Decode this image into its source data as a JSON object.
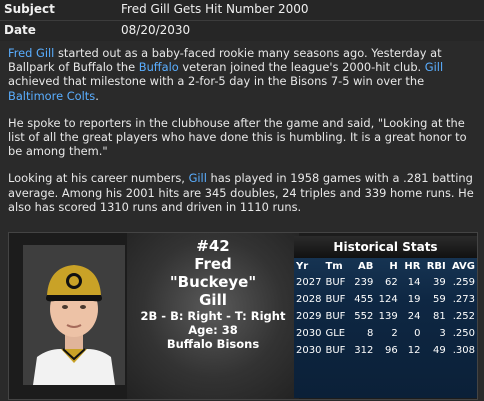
{
  "message": {
    "subject_label": "Subject",
    "subject": "Fred Gill Gets Hit Number 2000",
    "date_label": "Date",
    "date": "08/20/2030"
  },
  "body": {
    "p1": {
      "name": "Fred Gill",
      "t1": " started out as a baby-faced rookie many seasons ago. Yesterday at Ballpark of Buffalo the ",
      "team": "Buffalo",
      "t2": " veteran joined the league's 2000-hit club. ",
      "name_short": "Gill",
      "t3": " achieved that milestone with a 2-for-5 day in the Bisons 7-5 win over the ",
      "opponent": "Baltimore Colts",
      "t4": "."
    },
    "p2": "He spoke to reporters in the clubhouse after the game and said, \"Looking at the list of all the great players who have done this is humbling. It is a great honor to be among them.\"",
    "p3": {
      "t1": "Looking at his career numbers, ",
      "name_short": "Gill",
      "t2": " has played in 1958 games with a .281 batting average. Among his 2001 hits are 345 doubles, 24 triples and 339 home runs. He also has scored 1310 runs and driven in 1110 runs."
    }
  },
  "player": {
    "number": "#42",
    "first": "Fred",
    "nickname": "\"Buckeye\"",
    "last": "Gill",
    "position_line": "2B - B: Right - T: Right",
    "age_line": "Age: 38",
    "team": "Buffalo Bisons"
  },
  "stats": {
    "title": "Historical Stats",
    "headers": [
      "Yr",
      "Tm",
      "AB",
      "H",
      "HR",
      "RBI",
      "AVG"
    ],
    "rows": [
      [
        "2027",
        "BUF",
        "239",
        "62",
        "14",
        "39",
        ".259"
      ],
      [
        "2028",
        "BUF",
        "455",
        "124",
        "19",
        "59",
        ".273"
      ],
      [
        "2029",
        "BUF",
        "552",
        "139",
        "24",
        "81",
        ".252"
      ],
      [
        "2030",
        "GLE",
        "8",
        "2",
        "0",
        "3",
        ".250"
      ],
      [
        "2030",
        "BUF",
        "312",
        "96",
        "12",
        "49",
        ".308"
      ]
    ]
  },
  "colors": {
    "link": "#5aaeff",
    "cap_gold": "#c9a227",
    "stats_blue": "#0e2743"
  }
}
